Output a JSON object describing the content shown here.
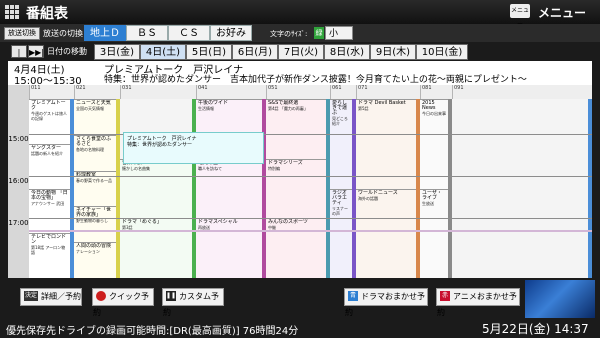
{
  "title_bar": {
    "title": "番組表",
    "menu_key": "メニュー",
    "menu_label": "メニュー"
  },
  "broadcast": {
    "switch_button": "放送切換",
    "switch_label": "放送の切換",
    "tabs": [
      {
        "label": "地上Ｄ",
        "active": true
      },
      {
        "label": "ＢＳ"
      },
      {
        "label": "ＣＳ"
      },
      {
        "label": "お好み"
      }
    ],
    "font_size_label": "文字のｻｲｽﾞ:",
    "font_size_badge": "緑",
    "font_size_value": "小"
  },
  "dates": {
    "prev": "|◀◀",
    "next": "▶▶|",
    "nav_label": "日付の移動",
    "tabs": [
      {
        "label": "3日(金)"
      },
      {
        "label": "4日(土)",
        "active": true
      },
      {
        "label": "5日(日)"
      },
      {
        "label": "6日(月)"
      },
      {
        "label": "7日(火)"
      },
      {
        "label": "8日(水)"
      },
      {
        "label": "9日(木)"
      },
      {
        "label": "10日(金)"
      }
    ]
  },
  "program": {
    "date": "4月4日(土)",
    "time": "15:00〜15:30",
    "title": "プレミアムトーク　戸沢レイナ",
    "description": "特集：世界が認めたダンサー　吉本加代子が新作ダンス披露！今月育てたい上の花〜両親にプレゼント〜"
  },
  "grid": {
    "times": [
      "15:00",
      "16:00",
      "17:00"
    ],
    "channels": [
      "011",
      "021",
      "031",
      "041",
      "051",
      "061",
      "071",
      "081",
      "091"
    ],
    "programs": [
      {
        "ch": 0,
        "title": "プレミアムトーク",
        "text": "今週のゲストは旅人の記録"
      },
      {
        "ch": 0,
        "title": "ヤングスター",
        "text": "話題の新人を紹介"
      },
      {
        "ch": 0,
        "title": "今日の動物 「日本の宝物」",
        "text": "アナウンサー 武田"
      },
      {
        "ch": 0,
        "title": "テレビでロンドン",
        "text": "第18話 アーロン物語"
      },
      {
        "ch": 1,
        "title": "ニュースと天気",
        "text": "全国の天気情報"
      },
      {
        "ch": 1,
        "title": "さくら食堂のふるさと",
        "text": "各地の名物料理"
      },
      {
        "ch": 1,
        "title": "料理教室",
        "text": "春の野菜で作る一品"
      },
      {
        "ch": 1,
        "title": "ネイチャー「世界の家族」",
        "text": "野生動物の暮らし"
      },
      {
        "ch": 1,
        "title": "人間の頭の冒険",
        "text": "ナレーション"
      },
      {
        "ch": 2,
        "title": "プレミアムトーク　戸沢レイナ",
        "text": "特集：世界が認めたダンサー"
      },
      {
        "ch": 2,
        "title": "音楽の旅",
        "text": "懐かしの名曲集"
      },
      {
        "ch": 2,
        "title": "ドラマ「めぐる」",
        "text": "第3話"
      },
      {
        "ch": 3,
        "title": "午後のワイド",
        "text": "生活情報"
      },
      {
        "ch": 3,
        "title": "地元の匠",
        "text": "職人を訪ねて"
      },
      {
        "ch": 3,
        "title": "ドラマスペシャル",
        "text": "再放送"
      },
      {
        "ch": 4,
        "title": "S&Sで最終選",
        "text": "第4話 「魔力の再審」"
      },
      {
        "ch": 4,
        "title": "ドラマシリーズ",
        "text": "特別編"
      },
      {
        "ch": 4,
        "title": "みんなのスポーツ",
        "text": "中継"
      },
      {
        "ch": 5,
        "title": "愛らしきで運ぶ",
        "text": "見どころ紹介"
      },
      {
        "ch": 5,
        "title": "ラジオバラエティ",
        "text": "リスナーの声"
      },
      {
        "ch": 6,
        "title": "ドラマ Devil Basket",
        "text": "第5話"
      },
      {
        "ch": 6,
        "title": "ワールドニュース",
        "text": "海外の話題"
      },
      {
        "ch": 7,
        "title": "2015 News",
        "text": "今日の出来事"
      },
      {
        "ch": 7,
        "title": "ユーザ・ライブ",
        "text": "生放送"
      }
    ]
  },
  "bottom_buttons": {
    "detail_key": "決定",
    "detail_label": "詳細／予約",
    "quick_label": "クイック予約",
    "custom_label": "カスタム予約",
    "drama_key": "青",
    "drama_label": "ドラマおまかせ予約",
    "anime_key": "赤",
    "anime_label": "アニメおまかせ予約"
  },
  "status": {
    "storage": "優先保存先ドライブの録画可能時間:[DR(最高画質)] 76時間24分",
    "clock": "5月22日(金) 14:37"
  },
  "colors": {
    "accent": "#2d7fd2",
    "quick": "#cc1d1d",
    "anime": "#c8102e",
    "drama": "#2d7fd2",
    "font_badge": "#2fa33a"
  }
}
